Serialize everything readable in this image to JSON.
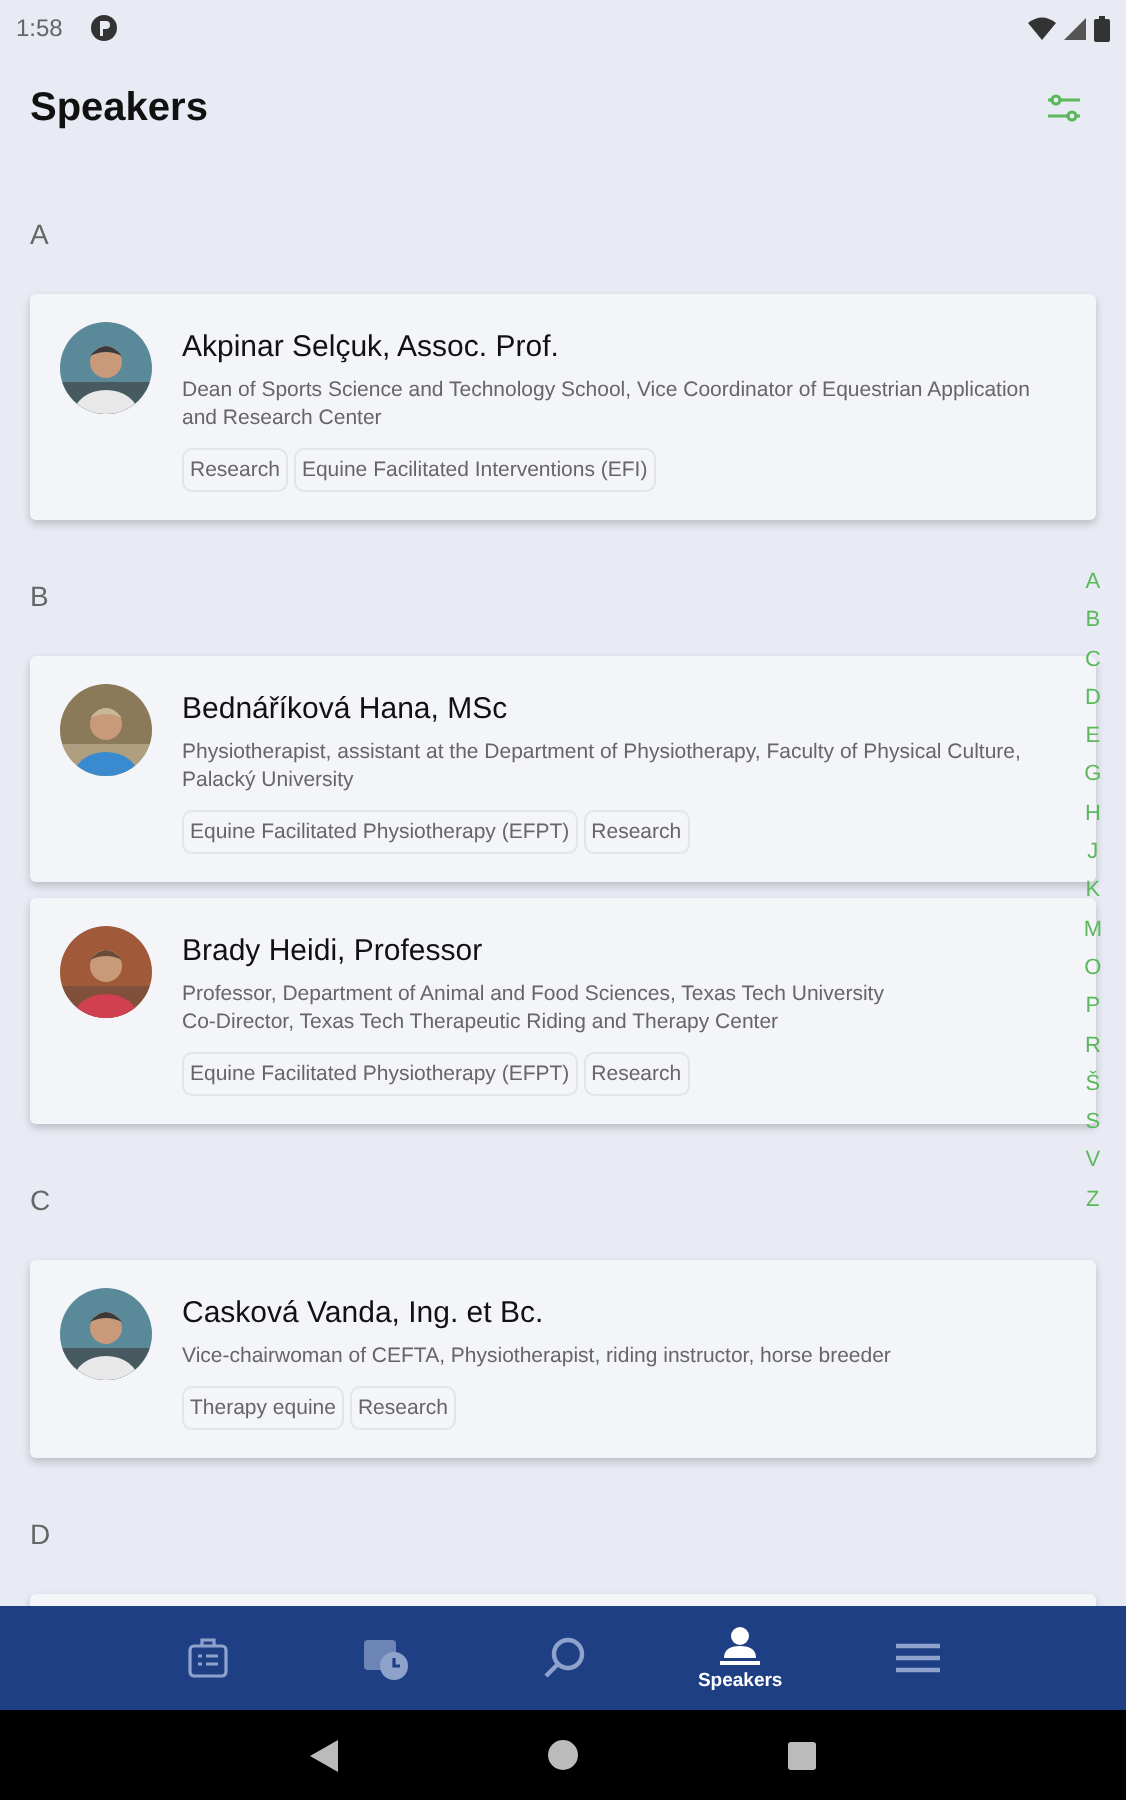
{
  "status_bar": {
    "time": "1:58"
  },
  "header": {
    "title": "Speakers"
  },
  "sections": [
    {
      "letter": "A",
      "speakers": [
        {
          "name": "Akpinar Selçuk, Assoc. Prof.",
          "description": "Dean of Sports Science and Technology School, Vice Coordinator of Equestrian Application and Research Center",
          "tags": [
            "Research",
            "Equine Facilitated Interventions (EFI)"
          ]
        }
      ]
    },
    {
      "letter": "B",
      "speakers": [
        {
          "name": "Bednáříková Hana, MSc",
          "description": "Physiotherapist, assistant at the Department of Physiotherapy, Faculty of Physical Culture, Palacký University",
          "tags": [
            "Equine Facilitated Physiotherapy (EFPT)",
            "Research"
          ]
        },
        {
          "name": "Brady Heidi, Professor",
          "description": "Professor, Department of Animal and Food Sciences, Texas Tech University\nCo-Director, Texas Tech Therapeutic Riding and Therapy Center",
          "tags": [
            "Equine Facilitated Physiotherapy (EFPT)",
            "Research"
          ]
        }
      ]
    },
    {
      "letter": "C",
      "speakers": [
        {
          "name": "Casková Vanda, Ing. et Bc.",
          "description": "Vice-chairwoman of CEFTA, Physiotherapist, riding instructor, horse breeder",
          "tags": [
            "Therapy equine",
            "Research"
          ]
        }
      ]
    },
    {
      "letter": "D"
    }
  ],
  "index": [
    "A",
    "B",
    "C",
    "D",
    "E",
    "G",
    "H",
    "J",
    "K",
    "M",
    "O",
    "P",
    "R",
    "Š",
    "S",
    "V",
    "Z"
  ],
  "nav": [
    {
      "kind": "agenda",
      "selected": false
    },
    {
      "kind": "schedule",
      "selected": false
    },
    {
      "kind": "search",
      "selected": false
    },
    {
      "kind": "speakers",
      "label": "Speakers",
      "selected": true
    },
    {
      "kind": "menu",
      "selected": false
    }
  ]
}
